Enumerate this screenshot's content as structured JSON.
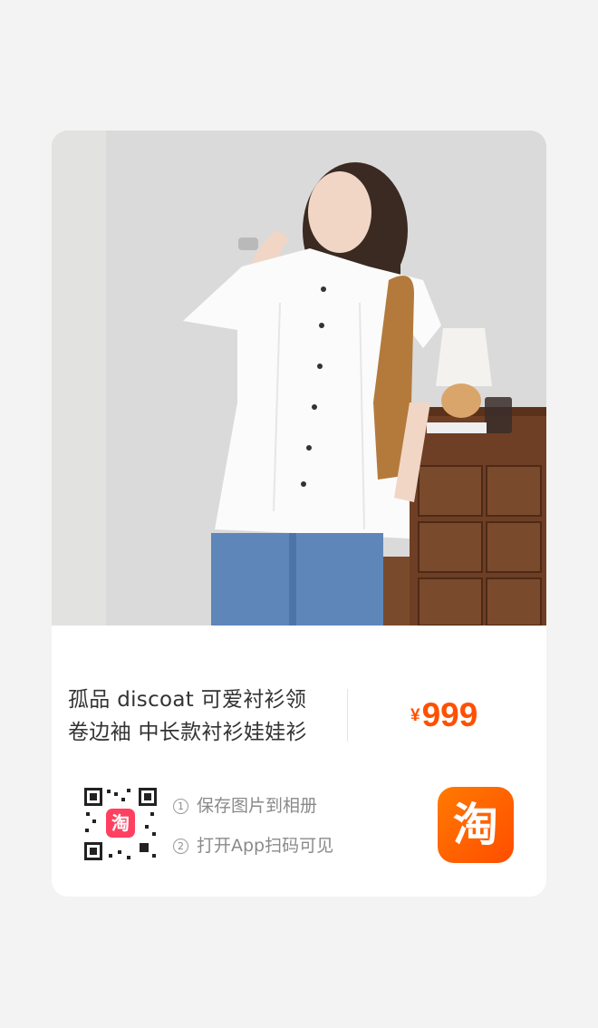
{
  "product": {
    "title_line1": "孤品 discoat 可爱衬衫领",
    "title_line2": "卷边袖 中长款衬衫娃娃衫",
    "price_currency": "¥",
    "price_value": "999"
  },
  "steps": [
    {
      "num": "1",
      "text": "保存图片到相册"
    },
    {
      "num": "2",
      "text": "打开App扫码可见"
    }
  ],
  "app_logo": {
    "glyph": "淘",
    "icon": "taobao-logo-icon"
  },
  "qr": {
    "icon": "qr-code-icon",
    "center_text": "淘"
  },
  "colors": {
    "price": "#ff5000",
    "logo_bg": "#ff5a00",
    "page_bg": "#f3f3f3",
    "card_bg": "#ffffff"
  }
}
